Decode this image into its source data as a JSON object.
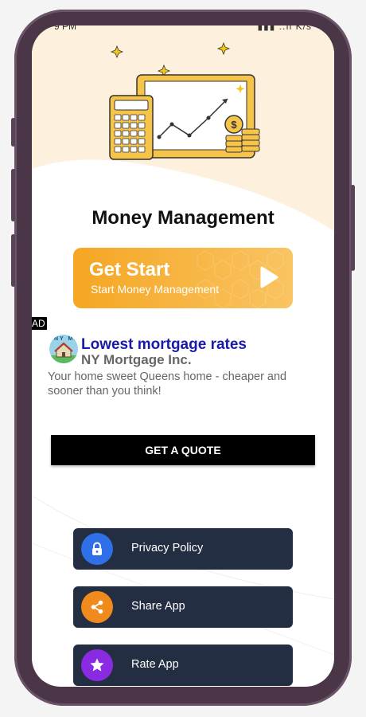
{
  "status_bar": {
    "time": "9 PM",
    "right": "▮▮▮  ..ıl K/s"
  },
  "screen": {
    "title": "Money Management"
  },
  "get_start": {
    "title": "Get Start",
    "subtitle": "Start Money Management",
    "icon": "play-icon"
  },
  "ad": {
    "badge": "AD",
    "title": "Lowest mortgage rates",
    "company": "NY Mortgage Inc.",
    "description": "Your home sweet Queens home - cheaper and sooner than you think!",
    "cta": "GET A QUOTE",
    "logo_text": "NY MI"
  },
  "menu": [
    {
      "label": "Privacy Policy",
      "icon": "lock-icon",
      "color": "#2f6fe8"
    },
    {
      "label": "Share App",
      "icon": "share-icon",
      "color": "#f08a1c"
    },
    {
      "label": "Rate App",
      "icon": "star-icon",
      "color": "#8a2be2"
    }
  ],
  "colors": {
    "accent": "#f5a623",
    "menu_bg": "#242e42",
    "ad_title": "#1a1aa8"
  }
}
